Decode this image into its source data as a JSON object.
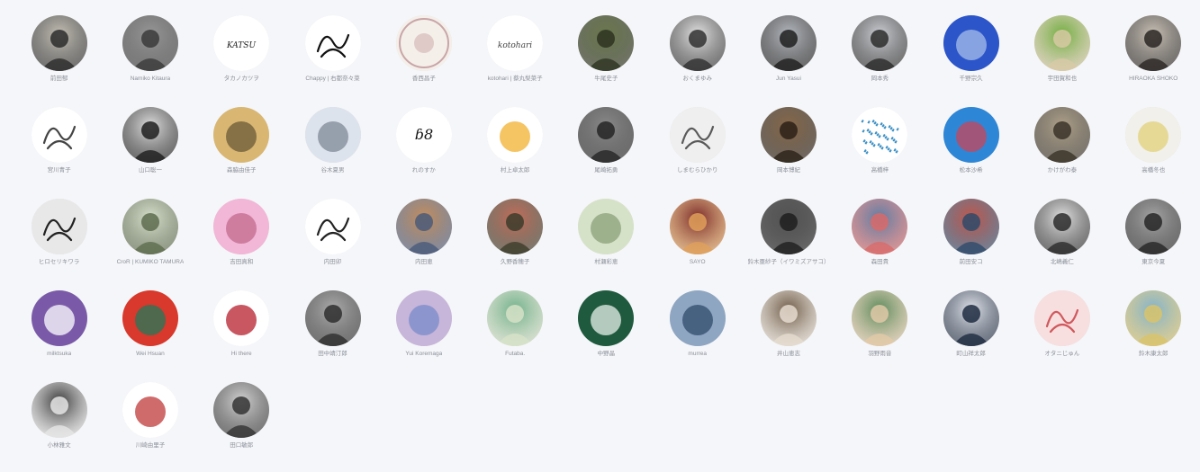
{
  "members": [
    {
      "name": "前田郁",
      "kind": "photo",
      "c1": "#c9c4b8",
      "c2": "#2b2b2b"
    },
    {
      "name": "Namiko Kitaura",
      "kind": "photo",
      "c1": "#9a9a9a",
      "c2": "#3a3a3a"
    },
    {
      "name": "タカノカツヲ",
      "kind": "text",
      "c1": "#ffffff",
      "c2": "#222222",
      "glyph": "KATSU"
    },
    {
      "name": "Chappy | 右都奈々菜",
      "kind": "scribble",
      "c1": "#ffffff",
      "c2": "#111111"
    },
    {
      "name": "香西昌子",
      "kind": "ring",
      "c1": "#f4efe9",
      "c2": "#c9a5a8"
    },
    {
      "name": "kotohari | 蔡丸梨菜子",
      "kind": "text",
      "c1": "#ffffff",
      "c2": "#444444",
      "glyph": "kotohari"
    },
    {
      "name": "牛尾史子",
      "kind": "photo",
      "c1": "#6d7a4e",
      "c2": "#2d3320"
    },
    {
      "name": "おくまゆみ",
      "kind": "photo",
      "c1": "#e7e7e7",
      "c2": "#303030"
    },
    {
      "name": "Jun Yasui",
      "kind": "photo",
      "c1": "#b9bdc4",
      "c2": "#1e1e1e"
    },
    {
      "name": "岡本秀",
      "kind": "photo",
      "c1": "#cfd2d8",
      "c2": "#2b2b2b"
    },
    {
      "name": "千野宗久",
      "kind": "flat",
      "c1": "#2c55c9",
      "c2": "#a6bde8"
    },
    {
      "name": "宇田賀和也",
      "kind": "photo",
      "c1": "#6fae3e",
      "c2": "#d8c9a6"
    },
    {
      "name": "HIRAOKA SHOKO",
      "kind": "photo",
      "c1": "#cfc7bb",
      "c2": "#2a2623"
    },
    {
      "name": "宮川青子",
      "kind": "scribble",
      "c1": "#ffffff",
      "c2": "#444444"
    },
    {
      "name": "山口聡一",
      "kind": "photo",
      "c1": "#e3e3e3",
      "c2": "#1d1d1d"
    },
    {
      "name": "森脇由佳子",
      "kind": "flat",
      "c1": "#d9b772",
      "c2": "#6a5a3a"
    },
    {
      "name": "谷木夏男",
      "kind": "flat",
      "c1": "#dde3ec",
      "c2": "#7d8897"
    },
    {
      "name": "れのすか",
      "kind": "text",
      "c1": "#ffffff",
      "c2": "#111111",
      "glyph": "ɓ8"
    },
    {
      "name": "村上卓太郎",
      "kind": "flat",
      "c1": "#ffffff",
      "c2": "#f2b130"
    },
    {
      "name": "尾崎拓勇",
      "kind": "photo",
      "c1": "#8d8d8d",
      "c2": "#252525"
    },
    {
      "name": "しまむらひかり",
      "kind": "scribble",
      "c1": "#efefef",
      "c2": "#5a5a5a"
    },
    {
      "name": "岡本博紀",
      "kind": "photo",
      "c1": "#8a6a4a",
      "c2": "#2b2016"
    },
    {
      "name": "高橋梓",
      "kind": "dots",
      "c1": "#ffffff",
      "c2": "#3a8fc4"
    },
    {
      "name": "松本沙希",
      "kind": "flat",
      "c1": "#2e86d6",
      "c2": "#c8455a"
    },
    {
      "name": "かけがわ泰",
      "kind": "photo",
      "c1": "#b3a58d",
      "c2": "#3a3328"
    },
    {
      "name": "高橋冬也",
      "kind": "flat",
      "c1": "#f1f0ea",
      "c2": "#e2d27a"
    },
    {
      "name": "ヒロセリキワラ",
      "kind": "scribble",
      "c1": "#e8e8e8",
      "c2": "#222222"
    },
    {
      "name": "CroR | KUMIKO TAMURA",
      "kind": "photo",
      "c1": "#d9e3cf",
      "c2": "#5d6b4c"
    },
    {
      "name": "吉田真和",
      "kind": "flat",
      "c1": "#f2b6d6",
      "c2": "#c16a8c"
    },
    {
      "name": "内田卯",
      "kind": "scribble",
      "c1": "#ffffff",
      "c2": "#222222"
    },
    {
      "name": "内田恵",
      "kind": "photo",
      "c1": "#c98f5a",
      "c2": "#4a5a7a"
    },
    {
      "name": "久野香穂子",
      "kind": "photo",
      "c1": "#c76e5b",
      "c2": "#3c3c2a"
    },
    {
      "name": "村瀬彩恵",
      "kind": "flat",
      "c1": "#d6e2c8",
      "c2": "#8aa07a"
    },
    {
      "name": "SAYO",
      "kind": "photo",
      "c1": "#7a2a2a",
      "c2": "#e0a05a"
    },
    {
      "name": "鈴木亜紗子（イワミズアサコ）",
      "kind": "photo",
      "c1": "#555555",
      "c2": "#1e1e1e"
    },
    {
      "name": "森田貴",
      "kind": "photo",
      "c1": "#5c7fa8",
      "c2": "#d96a6a"
    },
    {
      "name": "前田安コ",
      "kind": "photo",
      "c1": "#c5574a",
      "c2": "#2e4a6a"
    },
    {
      "name": "北嶋義仁",
      "kind": "photo",
      "c1": "#e6e6e6",
      "c2": "#2a2a2a"
    },
    {
      "name": "東京今夏",
      "kind": "photo",
      "c1": "#a9a9a9",
      "c2": "#262626"
    },
    {
      "name": "milktsuka",
      "kind": "flat",
      "c1": "#7a5aa8",
      "c2": "#ffffff"
    },
    {
      "name": "Wei Hsuan",
      "kind": "flat",
      "c1": "#d9382c",
      "c2": "#1f7a5a"
    },
    {
      "name": "Hi there",
      "kind": "flat",
      "c1": "#ffffff",
      "c2": "#b51f2e"
    },
    {
      "name": "田中靖汀郎",
      "kind": "photo",
      "c1": "#b0b0b0",
      "c2": "#2e2e2e"
    },
    {
      "name": "Yui Koremaga",
      "kind": "flat",
      "c1": "#c7b6d9",
      "c2": "#7a8acb"
    },
    {
      "name": "Futaba.",
      "kind": "photo",
      "c1": "#6fb08a",
      "c2": "#d7e2c8"
    },
    {
      "name": "中野晶",
      "kind": "flat",
      "c1": "#1f5a3e",
      "c2": "#e8f0ea"
    },
    {
      "name": "murrea",
      "kind": "flat",
      "c1": "#8ea6c2",
      "c2": "#2f4a6a"
    },
    {
      "name": "井山恵志",
      "kind": "photo",
      "c1": "#6d5a46",
      "c2": "#e6dcd0"
    },
    {
      "name": "羽野雨音",
      "kind": "photo",
      "c1": "#5a8a5a",
      "c2": "#e2c9a8"
    },
    {
      "name": "町山祥太郎",
      "kind": "photo",
      "c1": "#e5e8ee",
      "c2": "#1d2a40"
    },
    {
      "name": "オタニじゅん",
      "kind": "scribble",
      "c1": "#f7dfe0",
      "c2": "#d0585c"
    },
    {
      "name": "鈴木康太郎",
      "kind": "photo",
      "c1": "#7fb3d0",
      "c2": "#d9c36a"
    },
    {
      "name": "小林雅文",
      "kind": "photo",
      "c1": "#3a3a3a",
      "c2": "#e6e6e6"
    },
    {
      "name": "川崎由里子",
      "kind": "flat",
      "c1": "#ffffff",
      "c2": "#c03a3a"
    },
    {
      "name": "田口敏郎",
      "kind": "photo",
      "c1": "#d6d6d6",
      "c2": "#333333"
    }
  ]
}
